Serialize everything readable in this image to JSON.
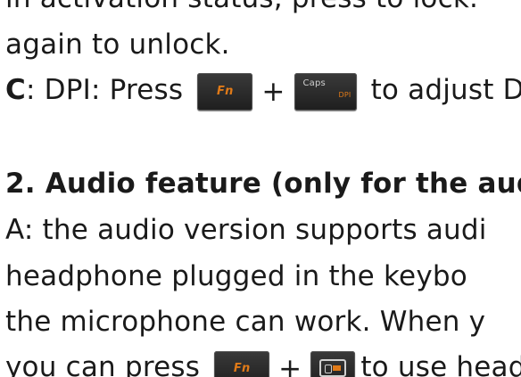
{
  "lines": {
    "line1": "in activation status, press to lock.",
    "line2": "again to unlock.",
    "line3": {
      "prefix_bold": "C",
      "prefix_rest": ": DPI: Press",
      "key1_label": "Fn",
      "plus": "+",
      "key2_main": "Caps",
      "key2_sub": "DPI",
      "suffix": "to adjust D"
    },
    "line4": "2. Audio feature (only for the aud",
    "line5": "A: the audio version supports audi",
    "line6": "headphone plugged in the keybo",
    "line7": "the microphone can work. When y",
    "line8": {
      "prefix": "you can press",
      "key1_label": "Fn",
      "plus": "+",
      "suffix": "to use head"
    }
  },
  "icons": {
    "headset_key_icon": "headphone-toggle-icon"
  },
  "colors": {
    "text": "#1a1a1a",
    "key_bg": "#2a2a2a",
    "key_accent": "#e07a18"
  }
}
